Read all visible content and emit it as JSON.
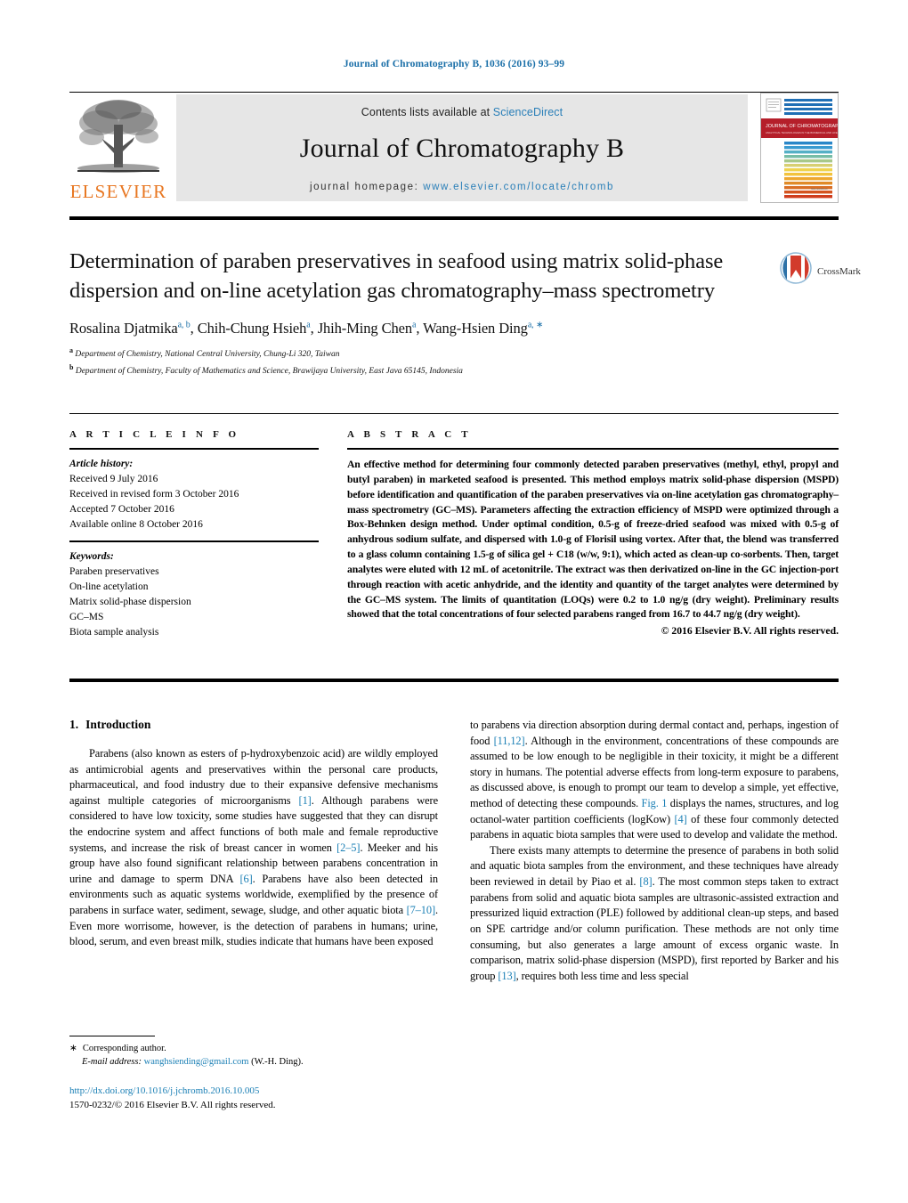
{
  "running_head": "Journal of Chromatography B, 1036 (2016) 93–99",
  "masthead": {
    "publisher_wordmark": "ELSEVIER",
    "contents_prefix": "Contents lists available at ",
    "contents_link": "ScienceDirect",
    "journal_title": "Journal of Chromatography B",
    "homepage_prefix": "journal homepage: ",
    "homepage_url": "www.elsevier.com/locate/chromb",
    "cover_title": "JOURNAL OF CHROMATOGRAPHY B"
  },
  "crossmark": {
    "label": "CrossMark"
  },
  "article": {
    "title": "Determination of paraben preservatives in seafood using matrix solid-phase dispersion and on-line acetylation gas chromatography–mass spectrometry",
    "authors": [
      {
        "name": "Rosalina Djatmika",
        "marks": "a, b"
      },
      {
        "name": "Chih-Chung Hsieh",
        "marks": "a"
      },
      {
        "name": "Jhih-Ming Chen",
        "marks": "a"
      },
      {
        "name": "Wang-Hsien Ding",
        "marks": "a, ∗"
      }
    ],
    "affiliations": [
      {
        "mark": "a",
        "text": "Department of Chemistry, National Central University, Chung-Li 320, Taiwan"
      },
      {
        "mark": "b",
        "text": "Department of Chemistry, Faculty of Mathematics and Science, Brawijaya University, East Java 65145, Indonesia"
      }
    ]
  },
  "article_info": {
    "heading": "A R T I C L E    I N F O",
    "history_head": "Article history:",
    "history": [
      "Received 9 July 2016",
      "Received in revised form 3 October 2016",
      "Accepted 7 October 2016",
      "Available online 8 October 2016"
    ],
    "keywords_head": "Keywords:",
    "keywords": [
      "Paraben preservatives",
      "On-line acetylation",
      "Matrix solid-phase dispersion",
      "GC–MS",
      "Biota sample analysis"
    ]
  },
  "abstract": {
    "heading": "A B S T R A C T",
    "text": "An effective method for determining four commonly detected paraben preservatives (methyl, ethyl, propyl and butyl paraben) in marketed seafood is presented. This method employs matrix solid-phase dispersion (MSPD) before identification and quantification of the paraben preservatives via on-line acetylation gas chromatography–mass spectrometry (GC–MS). Parameters affecting the extraction efficiency of MSPD were optimized through a Box-Behnken design method. Under optimal condition, 0.5-g of freeze-dried seafood was mixed with 0.5-g of anhydrous sodium sulfate, and dispersed with 1.0-g of Florisil using vortex. After that, the blend was transferred to a glass column containing 1.5-g of silica gel + C18 (w/w, 9:1), which acted as clean-up co-sorbents. Then, target analytes were eluted with 12 mL of acetonitrile. The extract was then derivatized on-line in the GC injection-port through reaction with acetic anhydride, and the identity and quantity of the target analytes were determined by the GC–MS system. The limits of quantitation (LOQs) were 0.2 to 1.0 ng/g (dry weight). Preliminary results showed that the total concentrations of four selected parabens ranged from 16.7 to 44.7 ng/g (dry weight).",
    "copyright": "© 2016 Elsevier B.V. All rights reserved."
  },
  "body": {
    "section_number": "1.",
    "section_title": "Introduction",
    "left_paragraph_1_a": "Parabens (also known as esters of p-hydroxybenzoic acid) are wildly employed as antimicrobial agents and preservatives within the personal care products, pharmaceutical, and food industry due to their expansive defensive mechanisms against multiple categories of microorganisms ",
    "cite_1": "[1]",
    "left_paragraph_1_b": ". Although parabens were considered to have low toxicity, some studies have suggested that they can disrupt the endocrine system and affect functions of both male and female reproductive systems, and increase the risk of breast cancer in women ",
    "cite_2_5": "[2–5]",
    "left_paragraph_1_c": ". Meeker and his group have also found significant relationship between parabens concentration in urine and damage to sperm DNA ",
    "cite_6": "[6]",
    "left_paragraph_1_d": ". Parabens have also been detected in environments such as aquatic systems worldwide, exemplified by the presence of parabens in surface water, sediment, sewage, sludge, and other aquatic biota ",
    "cite_7_10": "[7–10]",
    "left_paragraph_1_e": ". Even more worrisome, however, is the detection of parabens in humans; urine, blood, serum, and even breast milk, studies indicate that humans have been exposed",
    "right_paragraph_1_a": "to parabens via direction absorption during dermal contact and, perhaps, ingestion of food ",
    "cite_11_12": "[11,12]",
    "right_paragraph_1_b": ". Although in the environment, concentrations of these compounds are assumed to be low enough to be negligible in their toxicity, it might be a different story in humans. The potential adverse effects from long-term exposure to parabens, as discussed above, is enough to prompt our team to develop a simple, yet effective, method of detecting these compounds. ",
    "fig_link": "Fig. 1",
    "right_paragraph_1_c": " displays the names, structures, and log octanol-water partition coefficients (logKow) ",
    "cite_4": "[4]",
    "right_paragraph_1_d": " of these four commonly detected parabens in aquatic biota samples that were used to develop and validate the method.",
    "right_paragraph_2_a": "There exists many attempts to determine the presence of parabens in both solid and aquatic biota samples from the environment, and these techniques have already been reviewed in detail by Piao et al. ",
    "cite_8": "[8]",
    "right_paragraph_2_b": ". The most common steps taken to extract parabens from solid and aquatic biota samples are ultrasonic-assisted extraction and pressurized liquid extraction (PLE) followed by additional clean-up steps, and based on SPE cartridge and/or column purification. These methods are not only time consuming, but also generates a large amount of excess organic waste. In comparison, matrix solid-phase dispersion (MSPD), first reported by Barker and his group ",
    "cite_13": "[13]",
    "right_paragraph_2_c": ", requires both less time and less special"
  },
  "footnotes": {
    "corresponding_marker": "∗",
    "corresponding_text": "Corresponding author.",
    "email_label": "E-mail address:",
    "email": "wanghsiending@gmail.com",
    "email_owner": "(W.-H. Ding).",
    "doi_url": "http://dx.doi.org/10.1016/j.jchromb.2016.10.005",
    "issn_line": "1570-0232/© 2016 Elsevier B.V. All rights reserved."
  },
  "colors": {
    "link": "#1a7fb5",
    "elsevier_orange": "#e87722",
    "banner_gray": "#e6e6e6"
  }
}
